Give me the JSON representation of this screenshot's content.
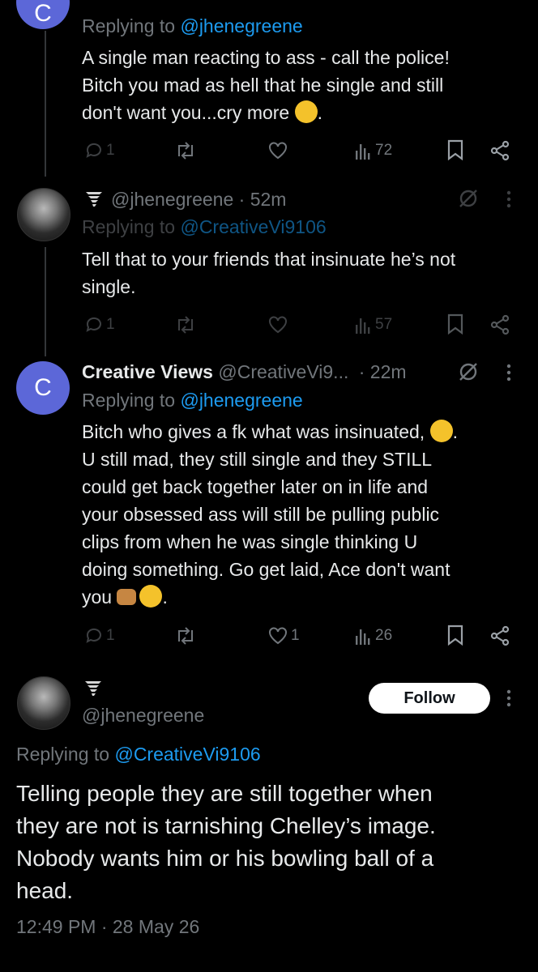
{
  "tweets": [
    {
      "avatar_letter": "C",
      "reply_prefix": "Replying to",
      "reply_handle": "@jhenegreene",
      "lines": [
        "A single man reacting to ass - call the police!",
        "Bitch you mad as hell that he single and still",
        "don't want you...cry more"
      ],
      "replies": "1",
      "views": "72"
    },
    {
      "handle": "@jhenegreene",
      "time": "· 52m",
      "reply_prefix": "Replying to",
      "reply_handle": "@CreativeVi9106",
      "lines": [
        "Tell that to your friends that insinuate he’s not",
        "single."
      ],
      "replies": "1",
      "views": "57"
    },
    {
      "avatar_letter": "C",
      "name": "Creative Views",
      "handle": "@CreativeVi9...",
      "time": "· 22m",
      "reply_prefix": "Replying to",
      "reply_handle": "@jhenegreene",
      "lines": [
        "Bitch who gives a fk what was insinuated,",
        "U still mad, they still single and they STILL",
        "could get back together later on in life and",
        "your obsessed ass will still be pulling public",
        "clips from when he was single thinking U",
        "doing something. Go get laid, Ace don't want",
        "you"
      ],
      "replies": "1",
      "likes": "1",
      "views": "26"
    }
  ],
  "main": {
    "handle": "@jhenegreene",
    "follow_label": "Follow",
    "reply_prefix": "Replying to",
    "reply_handle": "@CreativeVi9106",
    "lines": [
      "Telling people they are still together when",
      "they are not is tarnishing Chelley’s image.",
      "Nobody wants him or his bowling ball of a",
      "head."
    ],
    "timestamp": "12:49 PM · 28 May 26"
  },
  "icons": [
    "reply-icon",
    "retweet-icon",
    "like-icon",
    "views-icon",
    "bookmark-icon",
    "share-icon",
    "more-icon",
    "grok-icon",
    "tornado-icon"
  ],
  "colors": {
    "background": "#000000",
    "text": "#e7e9ea",
    "muted": "#71767b",
    "link": "#1d9bf0",
    "avatar": "#5c67d8"
  }
}
